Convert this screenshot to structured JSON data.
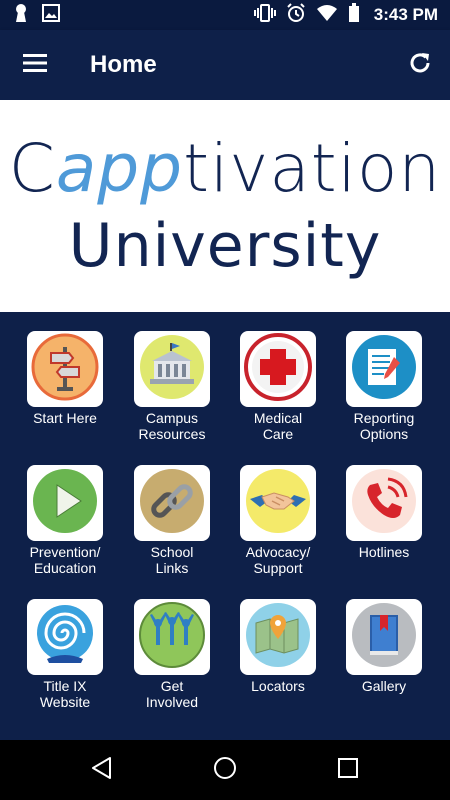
{
  "status_bar": {
    "time": "3:43 PM",
    "icons": [
      "keyhole-icon",
      "image-icon",
      "vibrate-icon",
      "alarm-icon",
      "wifi-icon",
      "battery-icon"
    ]
  },
  "app_bar": {
    "title": "Home",
    "menu_icon": "hamburger-menu-icon",
    "refresh_icon": "refresh-icon",
    "background": "#0e2049"
  },
  "banner": {
    "line1_pre": "C",
    "line1_accent": "app",
    "line1_post": "tivation",
    "line2": "University",
    "accent_color": "#4f9ad8",
    "text_color": "#122552"
  },
  "tiles": [
    {
      "id": "start-here",
      "label": [
        "Start Here"
      ],
      "icon": "signpost-icon"
    },
    {
      "id": "campus-resources",
      "label": [
        "Campus",
        "Resources"
      ],
      "icon": "campus-building-icon"
    },
    {
      "id": "medical-care",
      "label": [
        "Medical",
        "Care"
      ],
      "icon": "red-cross-icon"
    },
    {
      "id": "reporting-options",
      "label": [
        "Reporting",
        "Options"
      ],
      "icon": "report-document-icon"
    },
    {
      "id": "prevention-education",
      "label": [
        "Prevention/",
        "Education"
      ],
      "icon": "play-icon"
    },
    {
      "id": "school-links",
      "label": [
        "School",
        "Links"
      ],
      "icon": "chain-link-icon"
    },
    {
      "id": "advocacy-support",
      "label": [
        "Advocacy/",
        "Support"
      ],
      "icon": "handshake-icon"
    },
    {
      "id": "hotlines",
      "label": [
        "Hotlines"
      ],
      "icon": "phone-ringing-icon"
    },
    {
      "id": "title-ix-website",
      "label": [
        "Title IX",
        "Website"
      ],
      "icon": "spiral-globe-icon"
    },
    {
      "id": "get-involved",
      "label": [
        "Get",
        "Involved"
      ],
      "icon": "people-group-icon"
    },
    {
      "id": "locators",
      "label": [
        "Locators"
      ],
      "icon": "map-pin-icon"
    },
    {
      "id": "gallery",
      "label": [
        "Gallery"
      ],
      "icon": "book-icon"
    }
  ],
  "nav_bar": {
    "buttons": [
      "back-icon",
      "home-icon",
      "recents-icon"
    ]
  }
}
